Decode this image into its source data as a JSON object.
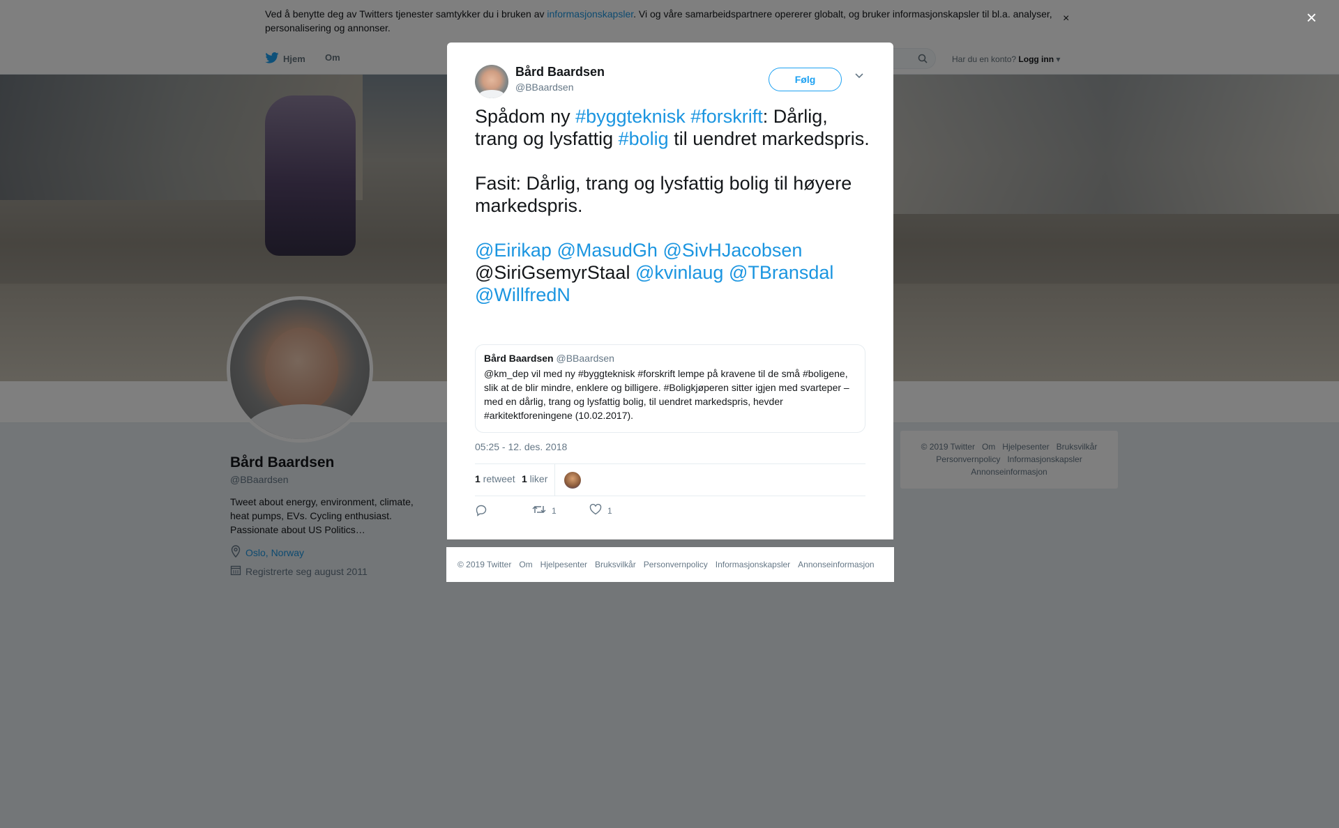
{
  "cookie": {
    "text_before": "Ved å benytte deg av Twitters tjenester samtykker du i bruken av ",
    "link": "informasjonskapsler",
    "text_after": ". Vi og våre samarbeidspartnere opererer globalt, og bruker informasjonskapsler til bl.a. analyser, personalisering og annonser.",
    "close": "×"
  },
  "nav": {
    "home": "Hjem",
    "about": "Om",
    "login_prompt": "Har du en konto?",
    "login": "Logg inn"
  },
  "profile": {
    "name": "Bård Baardsen",
    "handle": "@BBaardsen",
    "bio": "Tweet about energy, environment, climate, heat pumps, EVs. Cycling enthusiast. Passionate about US Politics…",
    "location": "Oslo, Norway",
    "joined": "Registrerte seg august 2011"
  },
  "right_footer": [
    "© 2019 Twitter",
    "Om",
    "Hjelpesenter",
    "Bruksvilkår",
    "Personvernpolicy",
    "Informasjonskapsler",
    "Annonseinformasjon"
  ],
  "overlay": {
    "close": "×"
  },
  "tweet": {
    "author_name": "Bård Baardsen",
    "author_handle": "@BBaardsen",
    "follow": "Følg",
    "text": {
      "p1": "Spådom ny ",
      "tag1": "#byggteknisk",
      "sp1": " ",
      "tag2": "#forskrift",
      "p2": ": Dårlig, trang og lysfattig ",
      "tag3": "#bolig",
      "p3": " til uendret markedspris.\n\nFasit: Dårlig, trang og lysfattig bolig til høyere markedspris.\n\n",
      "m1": "@Eirikap",
      "s1": " ",
      "m2": "@MasudGh",
      "s2": " ",
      "m3": "@SivHJacobsen",
      "plain": "\n@SiriGsemyrStaal ",
      "m4": "@kvinlaug",
      "s3": " ",
      "m5": "@TBransdal",
      "s4": "\n",
      "m6": "@WillfredN"
    },
    "quote": {
      "name": "Bård Baardsen",
      "handle": "@BBaardsen",
      "text": "@km_dep vil med ny #byggteknisk #forskrift lempe på kravene til de små #boligene, slik at de blir mindre, enklere og billigere. #Boligkjøperen sitter igjen med svarteper – med en dårlig, trang og lysfattig bolig, til uendret markedspris, hevder #arkitektforeningene (10.02.2017)."
    },
    "timestamp": "05:25 - 12. des. 2018",
    "retweets_count": "1",
    "retweets_label": " retweet",
    "likes_count": "1",
    "likes_label": " liker",
    "action_retweets": "1",
    "action_likes": "1"
  },
  "modal_footer": [
    "© 2019 Twitter",
    "Om",
    "Hjelpesenter",
    "Bruksvilkår",
    "Personvernpolicy",
    "Informasjonskapsler",
    "Annonseinformasjon"
  ]
}
